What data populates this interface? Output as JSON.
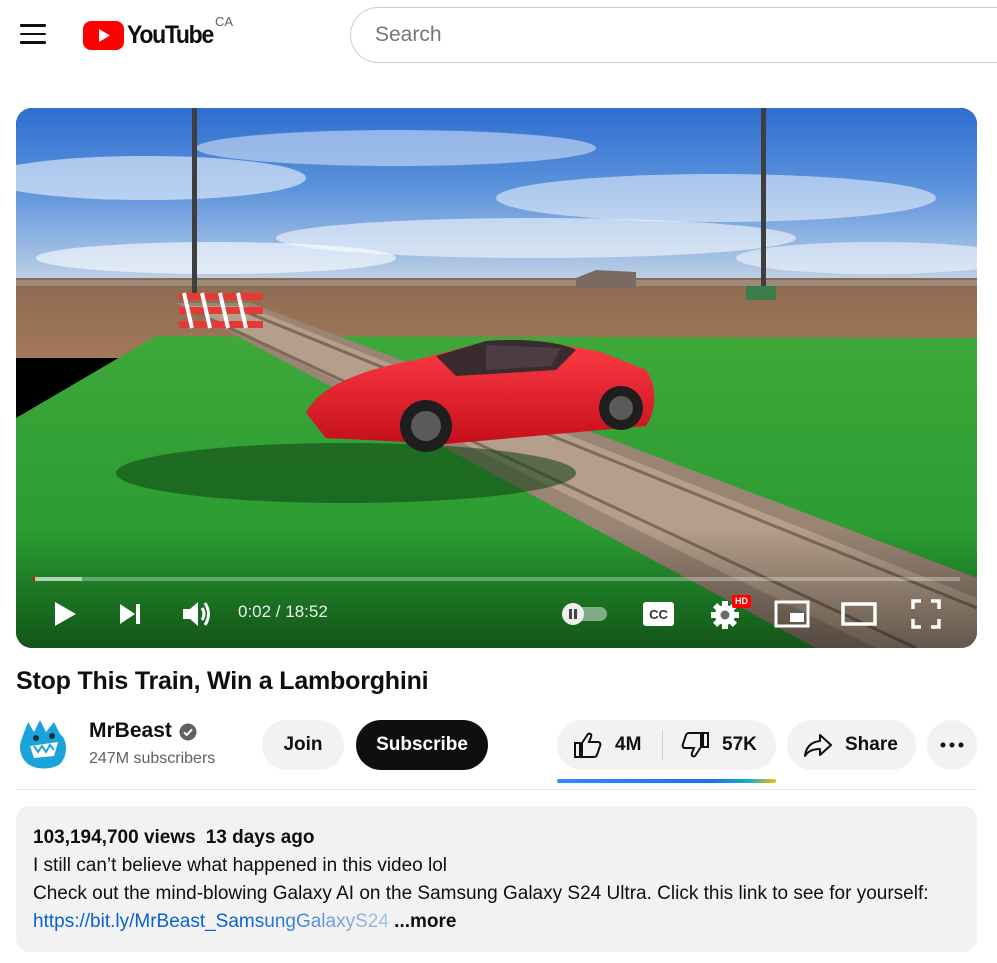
{
  "header": {
    "logo_text": "YouTube",
    "country": "CA",
    "search_placeholder": "Search"
  },
  "player": {
    "current_time": "0:02",
    "duration": "18:52",
    "time_display": "0:02 / 18:52",
    "progress_played": 0.002,
    "progress_buffered": 0.053,
    "settings_badge": "HD",
    "cc_label": "CC"
  },
  "video": {
    "title": "Stop This Train, Win a Lamborghini"
  },
  "channel": {
    "name": "MrBeast",
    "subscribers": "247M subscribers",
    "verified": true
  },
  "actions": {
    "join_label": "Join",
    "subscribe_label": "Subscribe",
    "likes": "4M",
    "dislikes": "57K",
    "share_label": "Share"
  },
  "description": {
    "views": "103,194,700 views",
    "date": "13 days ago",
    "line1": "I still can’t believe what happened in this video lol",
    "line2": "Check out the mind-blowing Galaxy AI on the Samsung Galaxy S24 Ultra. Click this link to see for yourself:",
    "link": "https://bit.ly/MrBeast_SamsungGalaxyS24",
    "more_label": "...more"
  },
  "colors": {
    "brand_red": "#ff0000",
    "link_blue": "#065fd4",
    "chip_bg": "#f2f2f2",
    "subscribe_bg": "#0f0f0f"
  }
}
